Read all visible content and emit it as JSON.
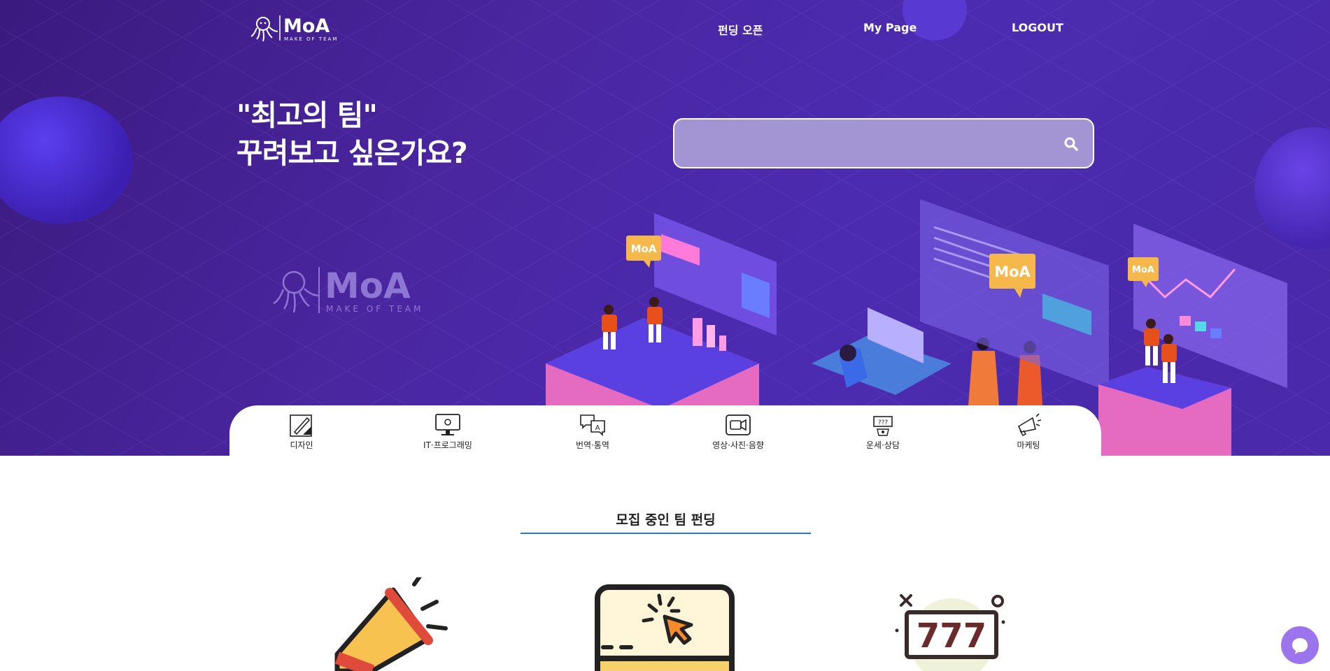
{
  "brand": {
    "name": "MoA",
    "tagline": "MAKE OF TEAM"
  },
  "nav": {
    "items": [
      "펀딩 오픈",
      "My Page",
      "LOGOUT"
    ]
  },
  "hero": {
    "headline_line1": "\"최고의 팀\"",
    "headline_line2": "꾸려보고 싶은가요?",
    "bubble_label": "MoA"
  },
  "search": {
    "value": "",
    "placeholder": "",
    "icon": "search-icon"
  },
  "categories": [
    {
      "label": "디자인",
      "icon": "design-icon"
    },
    {
      "label": "IT·프로그래밍",
      "icon": "monitor-icon"
    },
    {
      "label": "번역·통역",
      "icon": "translate-icon"
    },
    {
      "label": "영상·사진·음향",
      "icon": "video-icon"
    },
    {
      "label": "운세·상담",
      "icon": "slot-machine-icon"
    },
    {
      "label": "마케팅",
      "icon": "megaphone-icon"
    }
  ],
  "section": {
    "title": "모집 중인 팀 펀딩"
  },
  "cards": [
    {
      "icon": "megaphone-icon"
    },
    {
      "icon": "phone-click-icon"
    },
    {
      "icon": "slot-machine-icon"
    }
  ],
  "chat": {
    "icon": "chat-icon"
  },
  "colors": {
    "hero_bg": "#4a26a0",
    "accent_line": "#2f74c0",
    "chat_button": "#9b74ee",
    "search_bg": "#a394d3"
  }
}
